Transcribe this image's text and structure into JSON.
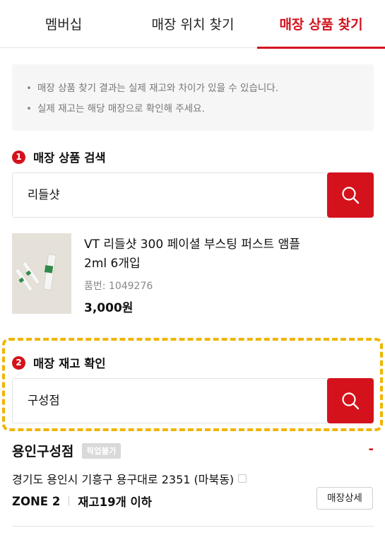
{
  "tabs": [
    {
      "label": "멤버십"
    },
    {
      "label": "매장 위치 찾기"
    },
    {
      "label": "매장 상품 찾기"
    }
  ],
  "notice": [
    "매장 상품 찾기 결과는 실제 재고와 차이가 있을 수 있습니다.",
    "실제 재고는 해당 매장으로 확인해 주세요."
  ],
  "section1": {
    "number": "1",
    "title": "매장 상품 검색",
    "search_value": "리들샷"
  },
  "product": {
    "name": "VT 리들샷 300 페이셜 부스팅 퍼스트 앰플 2ml 6개입",
    "code": "품번: 1049276",
    "price": "3,000원"
  },
  "section2": {
    "number": "2",
    "title": "매장 재고 확인",
    "search_value": "구성점"
  },
  "store": {
    "name": "용인구성점",
    "pickup_badge": "픽업불가",
    "status_mark": "-",
    "address": "경기도 용인시 기흥구 용구대로 2351 (마북동)",
    "zone": "ZONE 2",
    "stock": "재고19개 이하",
    "detail_button": "매장상세"
  },
  "colors": {
    "accent": "#d4121c",
    "highlight_dash": "#f0b400"
  }
}
